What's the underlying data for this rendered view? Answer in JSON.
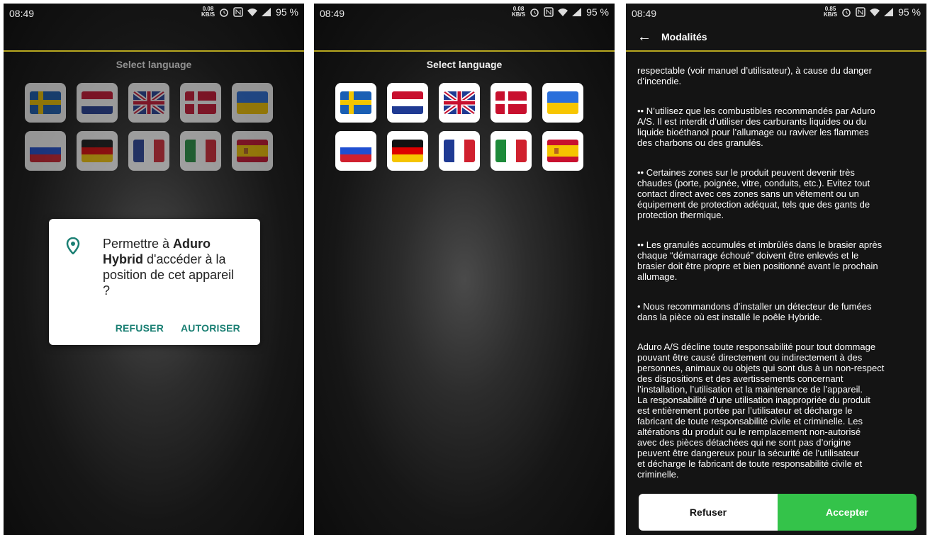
{
  "status": {
    "time": "08:49",
    "speed_1": "0.08",
    "speed_unit": "KB/S",
    "speed_3": "0.85",
    "battery": "95 %"
  },
  "language": {
    "title": "Select language",
    "flags": [
      "sweden-flag",
      "netherlands-flag",
      "uk-flag",
      "denmark-flag",
      "ukraine-flag",
      "russia-flag",
      "germany-flag",
      "france-flag",
      "italy-flag",
      "spain-flag"
    ]
  },
  "permission_dialog": {
    "line1_prefix": "Permettre à ",
    "app_name": "Aduro Hybrid",
    "line_rest": " d'accéder à la position de cet appareil ?",
    "refuse": "REFUSER",
    "allow": "AUTORISER"
  },
  "terms_screen": {
    "title": "Modalités",
    "paragraphs": [
      "respectable (voir  manuel d’utilisateur), à cause du danger\nd’incendie.",
      "•• N’utilisez  que les combustibles recommandés par Aduro\nA/S. Il est interdit  d’utiliser des carburants liquides ou du\nliquide bioéthanol pour  l’allumage ou raviver les flammes\ndes charbons ou des granulés.",
      "•• Certaines  zones sur le produit peuvent devenir très\nchaudes (porte, poignée,   vitre, conduits, etc.). Evitez tout\ncontact direct avec ces zones   sans un vêtement ou un\néquipement de protection adéquat,    tels que des gants de\nprotection thermique.",
      "•• Les  granulés accumulés et imbrûlés dans le brasier après\nchaque  “démarrage échoué” doivent être enlevés et le\nbrasier doit  être propre et bien positionné avant le prochain\nallumage.",
      " • Nous recommandons d’installer un détecteur de fumées\ndans la pièce où est installé le poêle Hybride.",
      "Aduro A/S décline toute responsabilité pour tout dommage\npouvant être causé directement ou indirectement à des\npersonnes, animaux ou objets qui sont dus à un non-respect\ndes dispositions et des avertissements concernant\nl’installation, l’utilisation et la maintenance de l’appareil.\nLa responsabilité d’une utilisation inappropriée du produit\nest entièrement portée par l’utilisateur et décharge le\nfabricant de toute responsabilité civile et criminelle. Les\naltérations du produit ou le remplacement non-autorisé\navec des pièces détachées qui ne sont pas d’origine\npeuvent être dangereux pour la sécurité de l’utilisateur\net décharge le fabricant de toute responsabilité civile et\ncriminelle."
    ],
    "refuse": "Refuser",
    "accept": "Accepter"
  },
  "colors": {
    "accent_line": "#b8a820",
    "dialog_button": "#1a7f73",
    "accept_green": "#34c34a"
  }
}
